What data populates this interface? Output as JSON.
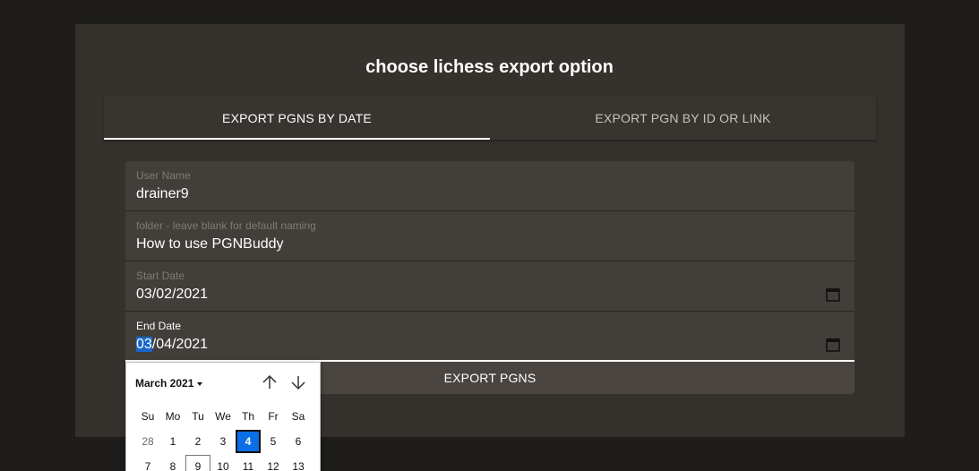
{
  "title": "choose lichess export option",
  "tabs": [
    {
      "label": "EXPORT PGNS BY DATE",
      "active": true
    },
    {
      "label": "EXPORT PGN BY ID OR LINK",
      "active": false
    }
  ],
  "fields": {
    "username": {
      "label": "User Name",
      "value": "drainer9"
    },
    "folder": {
      "label": "folder - leave blank for default naming",
      "value": "How to use PGNBuddy"
    },
    "start_date": {
      "label": "Start Date",
      "value": "03/02/2021"
    },
    "end_date": {
      "label": "End Date",
      "value_selected_part": "03",
      "value_rest": "/04/2021"
    }
  },
  "export_button": "EXPORT PGNS",
  "datepicker": {
    "month_label": "March 2021",
    "weekdays": [
      "Su",
      "Mo",
      "Tu",
      "We",
      "Th",
      "Fr",
      "Sa"
    ],
    "week1": [
      "28",
      "1",
      "2",
      "3",
      "4",
      "5",
      "6"
    ],
    "week2": [
      "7",
      "8",
      "9",
      "10",
      "11",
      "12",
      "13"
    ],
    "selected_day": "4",
    "today_day": "9"
  },
  "icons": {
    "calendar": "calendar-icon",
    "up": "arrow-up-icon",
    "down": "arrow-down-icon"
  },
  "colors": {
    "background": "#1e1d1b",
    "card": "#35312d",
    "field": "#423e3a",
    "accent": "#0a6ee6"
  }
}
